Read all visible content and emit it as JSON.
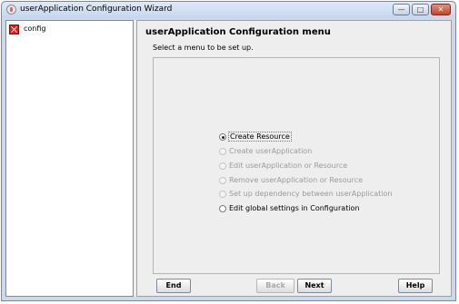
{
  "window": {
    "title": "userApplication Configuration Wizard",
    "controls": {
      "minimize": "—",
      "maximize": "□",
      "close": "✕"
    }
  },
  "tree": {
    "items": [
      {
        "label": "config",
        "icon": "config-icon"
      }
    ]
  },
  "main": {
    "title": "userApplication Configuration menu",
    "subtitle": "Select a menu to be set up.",
    "options": [
      {
        "label": "Create Resource",
        "selected": true,
        "enabled": true
      },
      {
        "label": "Create userApplication",
        "selected": false,
        "enabled": false
      },
      {
        "label": "Edit userApplication or Resource",
        "selected": false,
        "enabled": false
      },
      {
        "label": "Remove userApplication or Resource",
        "selected": false,
        "enabled": false
      },
      {
        "label": "Set up dependency between userApplication",
        "selected": false,
        "enabled": false
      },
      {
        "label": "Edit global settings in Configuration",
        "selected": false,
        "enabled": true
      }
    ]
  },
  "buttons": {
    "end": "End",
    "back": "Back",
    "next": "Next",
    "help": "Help"
  }
}
